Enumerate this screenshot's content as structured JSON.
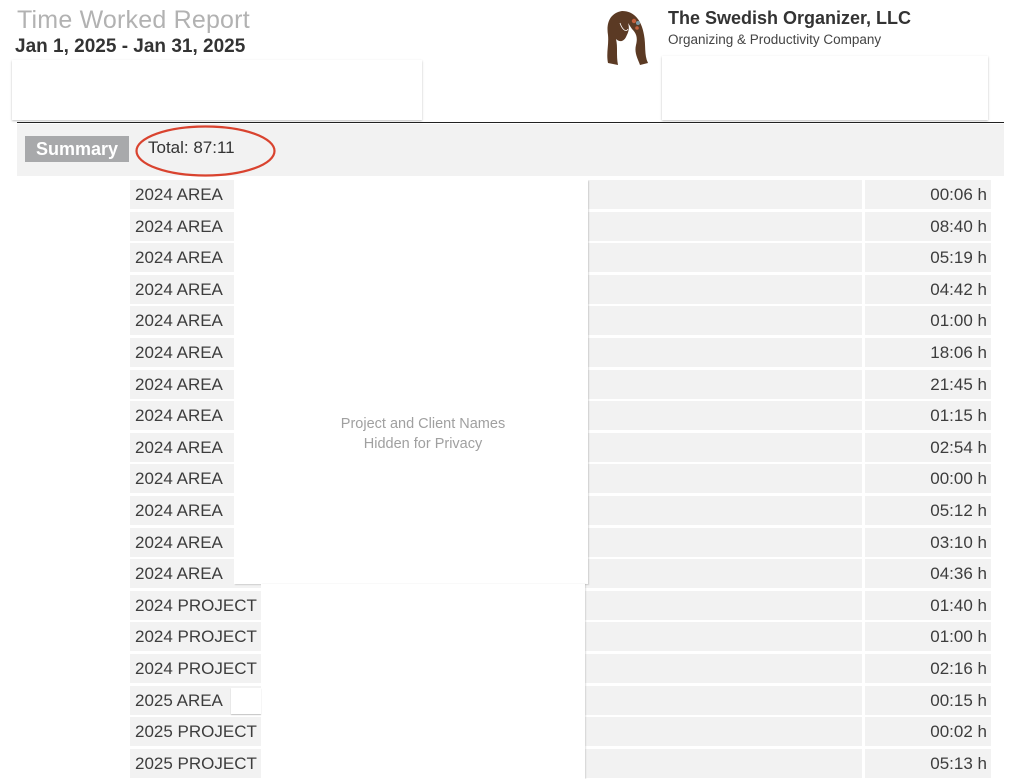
{
  "header": {
    "title": "Time Worked Report",
    "date_range": "Jan 1, 2025 - Jan 31, 2025",
    "company_name": "The Swedish Organizer, LLC",
    "company_tagline": "Organizing & Productivity Company",
    "logo_icon": "woman-silhouette-logo-icon"
  },
  "summary": {
    "label": "Summary",
    "total": "Total: 87:11",
    "highlight_color": "#d9432f"
  },
  "privacy_notice": {
    "line1": "Project and Client Names",
    "line2": "Hidden for Privacy"
  },
  "rows": [
    {
      "name": "2024 AREA",
      "time": "00:06 h"
    },
    {
      "name": "2024 AREA",
      "time": "08:40 h"
    },
    {
      "name": "2024 AREA",
      "time": "05:19 h"
    },
    {
      "name": "2024 AREA",
      "time": "04:42 h"
    },
    {
      "name": "2024 AREA",
      "time": "01:00 h"
    },
    {
      "name": "2024 AREA",
      "time": "18:06 h"
    },
    {
      "name": "2024 AREA",
      "time": "21:45 h"
    },
    {
      "name": "2024 AREA",
      "time": "01:15 h"
    },
    {
      "name": "2024 AREA",
      "time": "02:54 h"
    },
    {
      "name": "2024 AREA",
      "time": "00:00 h"
    },
    {
      "name": "2024 AREA",
      "time": "05:12 h"
    },
    {
      "name": "2024 AREA",
      "time": "03:10 h"
    },
    {
      "name": "2024 AREA",
      "time": "04:36 h"
    },
    {
      "name": "2024 PROJECT",
      "time": "01:40 h"
    },
    {
      "name": "2024 PROJECT",
      "time": "01:00 h"
    },
    {
      "name": "2024 PROJECT",
      "time": "02:16 h"
    },
    {
      "name": "2025 AREA",
      "time": "00:15 h"
    },
    {
      "name": "2025 PROJECT",
      "time": "00:02 h"
    },
    {
      "name": "2025 PROJECT",
      "time": "05:13 h"
    }
  ]
}
